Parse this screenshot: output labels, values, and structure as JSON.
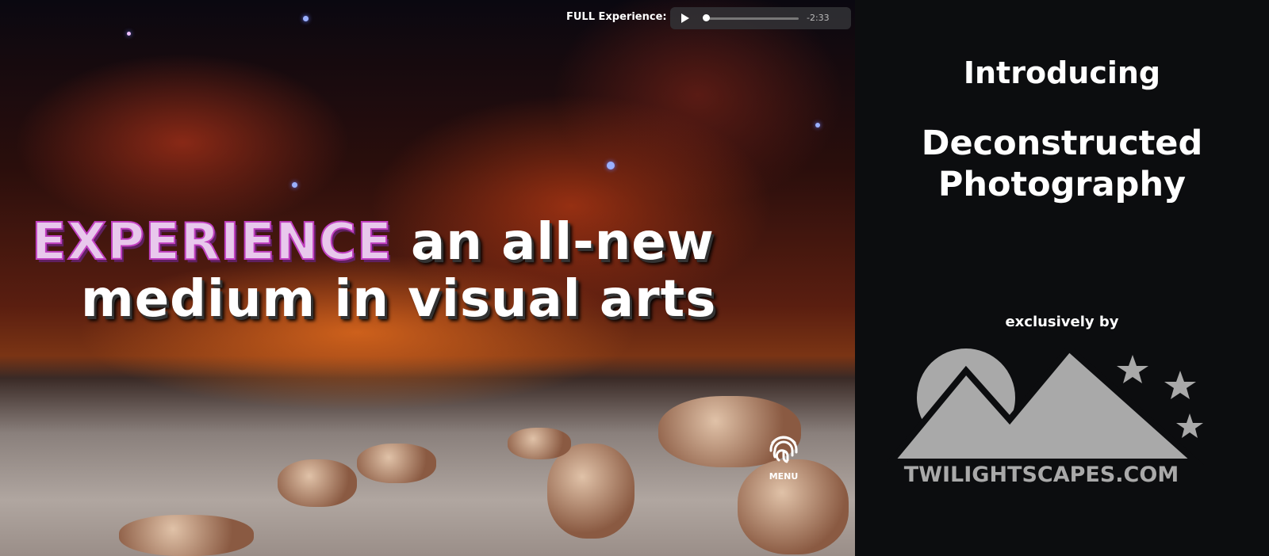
{
  "player": {
    "label": "FULL Experience:",
    "time_remaining": "-2:33",
    "progress": 0.01
  },
  "headline": {
    "highlight": "EXPERIENCE",
    "line1_rest": " an all-new",
    "line2": "medium in visual arts"
  },
  "menu": {
    "label": "MENU",
    "icon": "fingerprint-icon"
  },
  "panel": {
    "intro": "Introducing",
    "title_line1": "Deconstructed",
    "title_line2": "Photography",
    "exclusive": "exclusively by",
    "logo_text": "TWILIGHTSCAPES.COM"
  },
  "colors": {
    "panel_bg": "#0c0d0f",
    "logo_gray": "#a9a9a9",
    "highlight": "#c040c0"
  }
}
